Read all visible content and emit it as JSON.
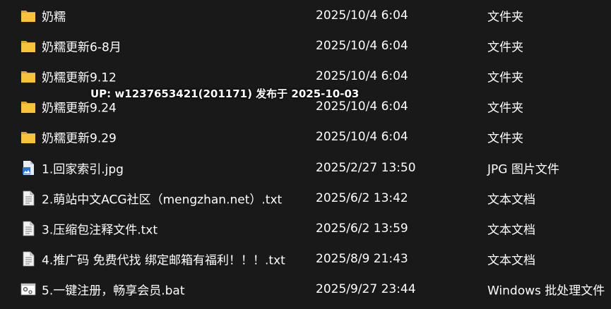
{
  "files": [
    {
      "name": "奶糯",
      "date": "2025/10/4 6:04",
      "type": "文件夹",
      "icon": "folder-icon"
    },
    {
      "name": "奶糯更新6-8月",
      "date": "2025/10/4 6:04",
      "type": "文件夹",
      "icon": "folder-icon"
    },
    {
      "name": "奶糯更新9.12",
      "date": "2025/10/4 6:04",
      "type": "文件夹",
      "icon": "folder-icon"
    },
    {
      "name": "奶糯更新9.24",
      "date": "2025/10/4 6:04",
      "type": "文件夹",
      "icon": "folder-icon"
    },
    {
      "name": "奶糯更新9.29",
      "date": "2025/10/4 6:04",
      "type": "文件夹",
      "icon": "folder-icon"
    },
    {
      "name": "1.回家索引.jpg",
      "date": "2025/2/27 13:50",
      "type": "JPG 图片文件",
      "icon": "image-file-icon"
    },
    {
      "name": "2.萌站中文ACG社区（mengzhan.net）.txt",
      "date": "2025/6/2 13:42",
      "type": "文本文档",
      "icon": "text-file-icon"
    },
    {
      "name": "3.压缩包注释文件.txt",
      "date": "2025/6/2 13:59",
      "type": "文本文档",
      "icon": "text-file-icon"
    },
    {
      "name": "4.推广码 免费代找 绑定邮箱有福利！！！.txt",
      "date": "2025/8/9 21:43",
      "type": "文本文档",
      "icon": "text-file-icon"
    },
    {
      "name": "5.一键注册，畅享会员.bat",
      "date": "2025/9/27 23:44",
      "type": "Windows 批处理文件",
      "icon": "batch-file-icon"
    }
  ],
  "overlay": {
    "text": "UP: w1237653421(201171) 发布于 2025-10-03"
  },
  "colors": {
    "background": "#191919",
    "folder": "#f8c23a",
    "text": "#ffffff"
  }
}
